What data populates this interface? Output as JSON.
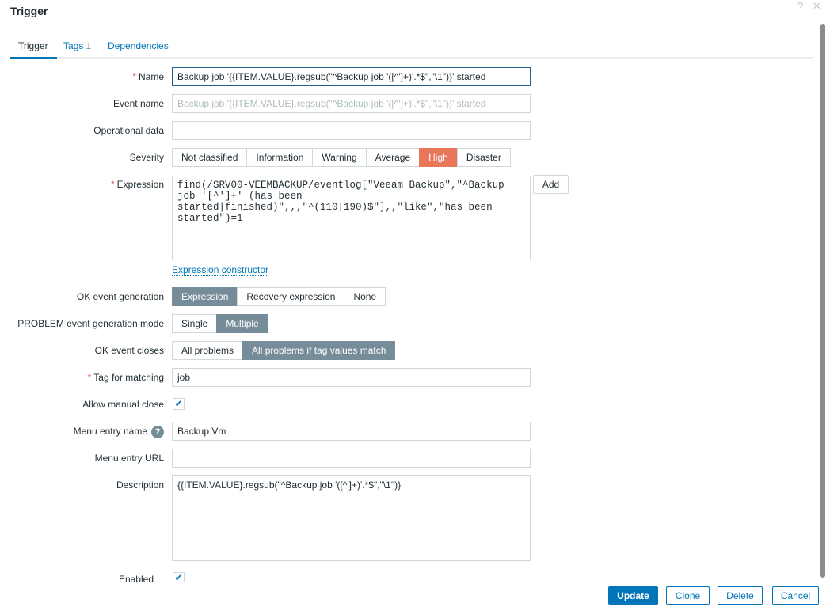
{
  "title": "Trigger",
  "tabs": [
    {
      "label": "Trigger"
    },
    {
      "label": "Tags",
      "count": "1"
    },
    {
      "label": "Dependencies"
    }
  ],
  "form": {
    "name": {
      "label": "Name",
      "value": "Backup job '{{ITEM.VALUE}.regsub(\"^Backup job '([^']+)'.*$\",\"\\1\")}' started"
    },
    "event_name": {
      "label": "Event name",
      "placeholder": "Backup job '{{ITEM.VALUE}.regsub(\"^Backup job '([^']+)'.*$\",\"\\1\")}' started"
    },
    "operational_data": {
      "label": "Operational data",
      "value": ""
    },
    "severity": {
      "label": "Severity",
      "options": [
        "Not classified",
        "Information",
        "Warning",
        "Average",
        "High",
        "Disaster"
      ],
      "selected": "High"
    },
    "expression": {
      "label": "Expression",
      "value": "find(/SRV00-VEEMBACKUP/eventlog[\"Veeam Backup\",\"^Backup job '[^']+' (has been started|finished)\",,,\"^(110|190)$\"],,\"like\",\"has been started\")=1",
      "add_label": "Add",
      "constructor_link": "Expression constructor"
    },
    "ok_event_generation": {
      "label": "OK event generation",
      "options": [
        "Expression",
        "Recovery expression",
        "None"
      ],
      "selected": "Expression"
    },
    "problem_mode": {
      "label": "PROBLEM event generation mode",
      "options": [
        "Single",
        "Multiple"
      ],
      "selected": "Multiple"
    },
    "ok_event_closes": {
      "label": "OK event closes",
      "options": [
        "All problems",
        "All problems if tag values match"
      ],
      "selected": "All problems if tag values match"
    },
    "tag_for_matching": {
      "label": "Tag for matching",
      "value": "job"
    },
    "allow_manual_close": {
      "label": "Allow manual close",
      "checked": true
    },
    "menu_entry_name": {
      "label": "Menu entry name",
      "value": "Backup Vm",
      "help": "?"
    },
    "menu_entry_url": {
      "label": "Menu entry URL",
      "value": ""
    },
    "description": {
      "label": "Description",
      "value": "{{ITEM.VALUE}.regsub(\"^Backup job '([^']+)'.*$\",\"\\1\")}"
    },
    "enabled": {
      "label": "Enabled",
      "checked": true
    }
  },
  "footer": {
    "update": "Update",
    "clone": "Clone",
    "delete": "Delete",
    "cancel": "Cancel"
  },
  "icons": {
    "help": "?",
    "close": "✕",
    "check": "✔"
  }
}
